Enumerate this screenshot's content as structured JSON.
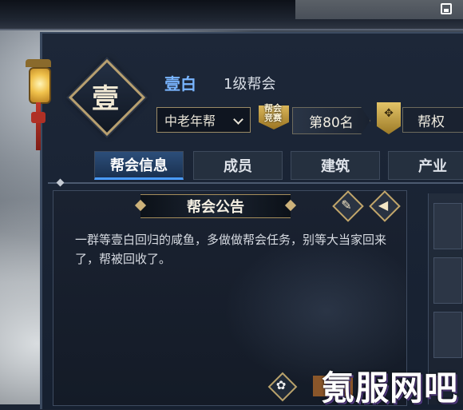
{
  "guild": {
    "emblem_char": "壹",
    "name": "壹白",
    "level": "1级帮会",
    "type_selected": "中老年帮",
    "rank_badge_line1": "帮会",
    "rank_badge_line2": "竞赛",
    "rank": "第80名",
    "rights_label": "帮权"
  },
  "tabs": [
    {
      "label": "帮会信息",
      "active": true
    },
    {
      "label": "成员",
      "active": false
    },
    {
      "label": "建筑",
      "active": false
    },
    {
      "label": "产业",
      "active": false
    }
  ],
  "notice": {
    "title": "帮会公告",
    "text": "一群等壹白回归的咸鱼，多做做帮会任务，别等大当家回来了，帮被回收了。"
  },
  "icons": {
    "edit": "edit-icon",
    "announce": "megaphone-icon",
    "settings": "settings-icon",
    "save": "save-icon"
  },
  "watermark": "氪服网吧",
  "colors": {
    "accent_blue": "#79b5ff",
    "gold_trim": "#b8a070",
    "active_tab": "#2c4e7a"
  }
}
